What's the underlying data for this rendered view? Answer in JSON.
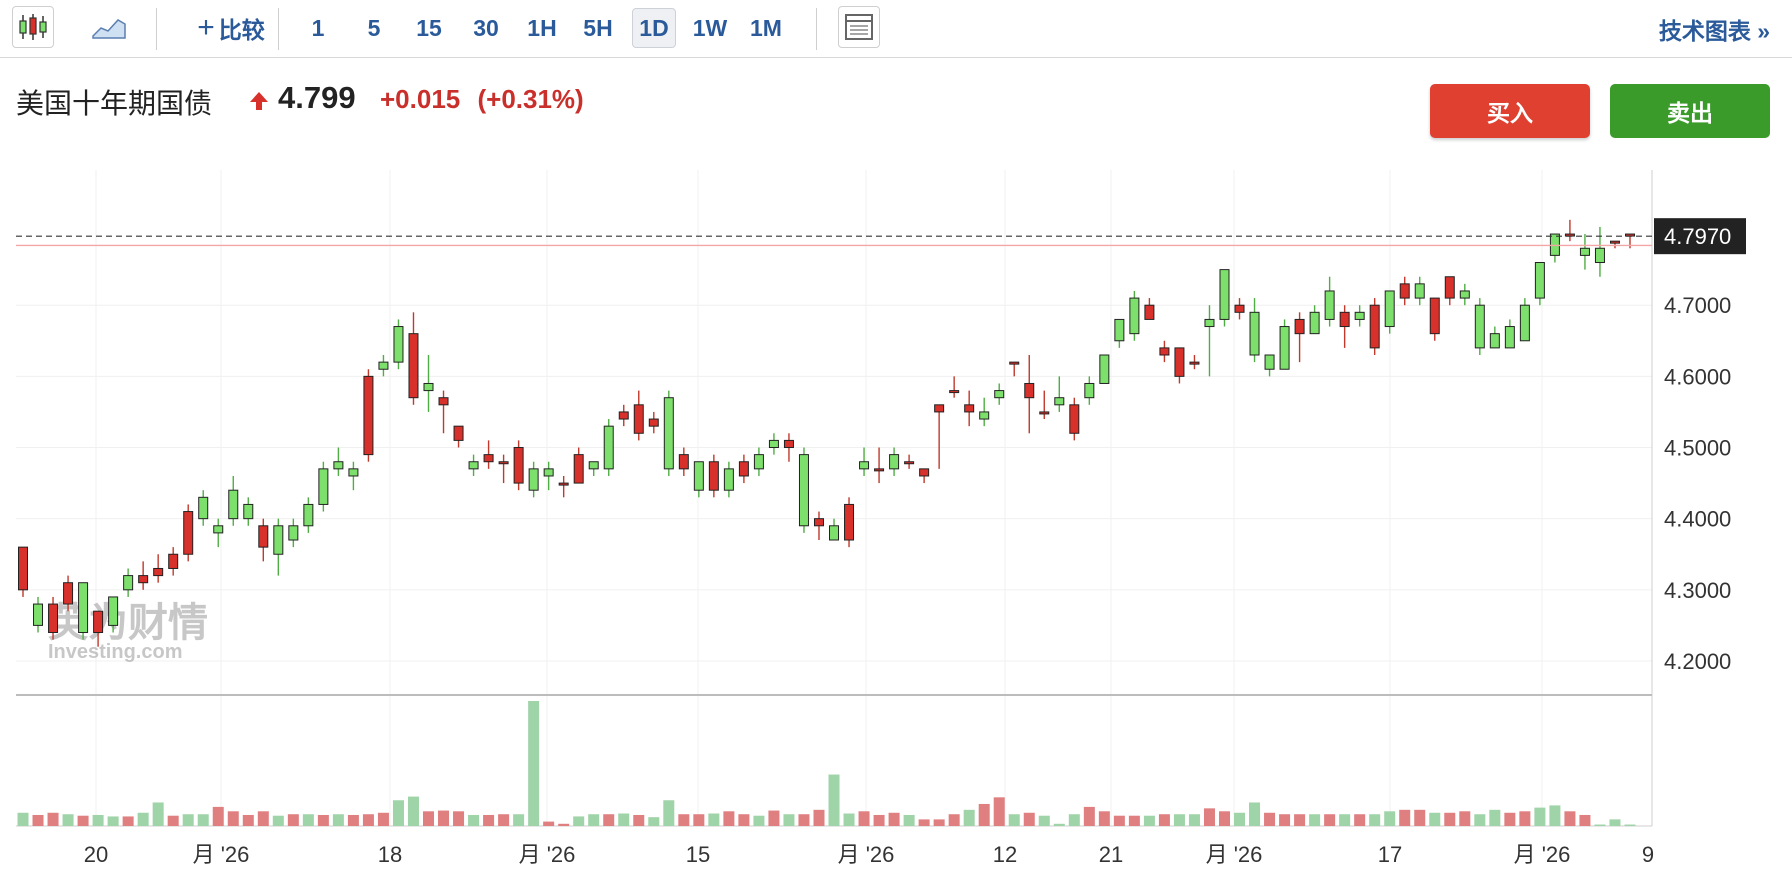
{
  "toolbar": {
    "compare_label": "比较",
    "intervals": [
      "1",
      "5",
      "15",
      "30",
      "1H",
      "5H",
      "1D",
      "1W",
      "1M"
    ],
    "active_interval": "1D",
    "tech_chart_label": "技术图表 »"
  },
  "instrument": {
    "name": "美国十年期国债",
    "price": "4.799",
    "change": "+0.015",
    "change_pct": "(+0.31%)",
    "direction": "up"
  },
  "actions": {
    "buy_label": "买入",
    "sell_label": "卖出"
  },
  "watermark": {
    "cn": "英为财情",
    "en": "Investing.com"
  },
  "colors": {
    "up": "#d8302a",
    "down": "#7ee06c",
    "up_vol": "#df7f80",
    "down_vol": "#9fd3a8",
    "accent": "#2a5a9a"
  },
  "chart_data": {
    "type": "candlestick",
    "current_price_label": "4.7970",
    "current_price": 4.797,
    "ref_price": 4.784,
    "y_ticks": [
      "4.2000",
      "4.3000",
      "4.4000",
      "4.5000",
      "4.6000",
      "4.7000"
    ],
    "ylim": [
      4.155,
      4.89
    ],
    "x_tick_labels": [
      "20",
      "月 '26",
      "18",
      "月 '26",
      "15",
      "月 '26",
      "12",
      "21",
      "月 '26",
      "17",
      "月 '26",
      "9"
    ],
    "candles": [
      [
        4.3,
        4.36,
        4.29,
        4.36
      ],
      [
        4.28,
        4.25,
        4.24,
        4.29
      ],
      [
        4.24,
        4.28,
        4.23,
        4.29
      ],
      [
        4.28,
        4.31,
        4.27,
        4.32
      ],
      [
        4.31,
        4.24,
        4.23,
        4.31
      ],
      [
        4.24,
        4.27,
        4.22,
        4.27
      ],
      [
        4.29,
        4.25,
        4.24,
        4.29
      ],
      [
        4.32,
        4.3,
        4.29,
        4.33
      ],
      [
        4.31,
        4.32,
        4.3,
        4.34
      ],
      [
        4.32,
        4.33,
        4.31,
        4.35
      ],
      [
        4.33,
        4.35,
        4.32,
        4.36
      ],
      [
        4.35,
        4.41,
        4.34,
        4.42
      ],
      [
        4.43,
        4.4,
        4.39,
        4.44
      ],
      [
        4.39,
        4.38,
        4.36,
        4.4
      ],
      [
        4.44,
        4.4,
        4.39,
        4.46
      ],
      [
        4.42,
        4.4,
        4.39,
        4.43
      ],
      [
        4.36,
        4.39,
        4.34,
        4.4
      ],
      [
        4.39,
        4.35,
        4.32,
        4.4
      ],
      [
        4.39,
        4.37,
        4.36,
        4.4
      ],
      [
        4.42,
        4.39,
        4.38,
        4.43
      ],
      [
        4.47,
        4.42,
        4.41,
        4.48
      ],
      [
        4.48,
        4.47,
        4.46,
        4.5
      ],
      [
        4.47,
        4.46,
        4.44,
        4.48
      ],
      [
        4.49,
        4.6,
        4.48,
        4.61
      ],
      [
        4.62,
        4.61,
        4.6,
        4.63
      ],
      [
        4.67,
        4.62,
        4.61,
        4.68
      ],
      [
        4.57,
        4.66,
        4.56,
        4.69
      ],
      [
        4.59,
        4.58,
        4.55,
        4.63
      ],
      [
        4.56,
        4.57,
        4.52,
        4.58
      ],
      [
        4.51,
        4.53,
        4.5,
        4.53
      ],
      [
        4.48,
        4.47,
        4.46,
        4.49
      ],
      [
        4.48,
        4.49,
        4.47,
        4.51
      ],
      [
        4.48,
        4.48,
        4.45,
        4.49
      ],
      [
        4.45,
        4.5,
        4.44,
        4.51
      ],
      [
        4.47,
        4.44,
        4.43,
        4.48
      ],
      [
        4.47,
        4.46,
        4.44,
        4.48
      ],
      [
        4.45,
        4.45,
        4.43,
        4.46
      ],
      [
        4.45,
        4.49,
        4.45,
        4.5
      ],
      [
        4.48,
        4.47,
        4.46,
        4.48
      ],
      [
        4.53,
        4.47,
        4.46,
        4.54
      ],
      [
        4.54,
        4.55,
        4.53,
        4.56
      ],
      [
        4.52,
        4.56,
        4.51,
        4.58
      ],
      [
        4.53,
        4.54,
        4.52,
        4.55
      ],
      [
        4.57,
        4.47,
        4.46,
        4.58
      ],
      [
        4.47,
        4.49,
        4.46,
        4.5
      ],
      [
        4.48,
        4.44,
        4.43,
        4.48
      ],
      [
        4.44,
        4.48,
        4.43,
        4.49
      ],
      [
        4.47,
        4.44,
        4.43,
        4.48
      ],
      [
        4.46,
        4.48,
        4.45,
        4.49
      ],
      [
        4.49,
        4.47,
        4.46,
        4.5
      ],
      [
        4.51,
        4.5,
        4.49,
        4.52
      ],
      [
        4.5,
        4.51,
        4.48,
        4.52
      ],
      [
        4.49,
        4.39,
        4.38,
        4.5
      ],
      [
        4.39,
        4.4,
        4.37,
        4.41
      ],
      [
        4.39,
        4.37,
        4.37,
        4.4
      ],
      [
        4.37,
        4.42,
        4.36,
        4.43
      ],
      [
        4.48,
        4.47,
        4.46,
        4.5
      ],
      [
        4.47,
        4.47,
        4.45,
        4.5
      ],
      [
        4.49,
        4.47,
        4.46,
        4.5
      ],
      [
        4.48,
        4.48,
        4.47,
        4.49
      ],
      [
        4.46,
        4.47,
        4.45,
        4.47
      ],
      [
        4.55,
        4.56,
        4.47,
        4.56
      ],
      [
        4.58,
        4.58,
        4.57,
        4.6
      ],
      [
        4.55,
        4.56,
        4.53,
        4.58
      ],
      [
        4.55,
        4.54,
        4.53,
        4.57
      ],
      [
        4.58,
        4.57,
        4.56,
        4.59
      ],
      [
        4.62,
        4.62,
        4.6,
        4.62
      ],
      [
        4.57,
        4.59,
        4.52,
        4.63
      ],
      [
        4.55,
        4.55,
        4.54,
        4.58
      ],
      [
        4.57,
        4.56,
        4.55,
        4.6
      ],
      [
        4.52,
        4.56,
        4.51,
        4.57
      ],
      [
        4.59,
        4.57,
        4.56,
        4.6
      ],
      [
        4.63,
        4.59,
        4.59,
        4.63
      ],
      [
        4.68,
        4.65,
        4.64,
        4.68
      ],
      [
        4.71,
        4.66,
        4.65,
        4.72
      ],
      [
        4.68,
        4.7,
        4.68,
        4.71
      ],
      [
        4.63,
        4.64,
        4.62,
        4.65
      ],
      [
        4.6,
        4.64,
        4.59,
        4.64
      ],
      [
        4.62,
        4.62,
        4.61,
        4.63
      ],
      [
        4.68,
        4.67,
        4.6,
        4.7
      ],
      [
        4.75,
        4.68,
        4.67,
        4.75
      ],
      [
        4.69,
        4.7,
        4.68,
        4.71
      ],
      [
        4.69,
        4.63,
        4.62,
        4.71
      ],
      [
        4.63,
        4.61,
        4.6,
        4.63
      ],
      [
        4.67,
        4.61,
        4.61,
        4.68
      ],
      [
        4.66,
        4.68,
        4.62,
        4.69
      ],
      [
        4.69,
        4.66,
        4.66,
        4.7
      ],
      [
        4.72,
        4.68,
        4.67,
        4.74
      ],
      [
        4.67,
        4.69,
        4.64,
        4.7
      ],
      [
        4.69,
        4.68,
        4.67,
        4.7
      ],
      [
        4.64,
        4.7,
        4.63,
        4.71
      ],
      [
        4.72,
        4.67,
        4.66,
        4.72
      ],
      [
        4.71,
        4.73,
        4.7,
        4.74
      ],
      [
        4.73,
        4.71,
        4.7,
        4.74
      ],
      [
        4.66,
        4.71,
        4.65,
        4.71
      ],
      [
        4.71,
        4.74,
        4.7,
        4.74
      ],
      [
        4.72,
        4.71,
        4.7,
        4.73
      ],
      [
        4.7,
        4.64,
        4.63,
        4.71
      ],
      [
        4.66,
        4.64,
        4.64,
        4.67
      ],
      [
        4.67,
        4.64,
        4.64,
        4.68
      ],
      [
        4.7,
        4.65,
        4.65,
        4.71
      ],
      [
        4.76,
        4.71,
        4.7,
        4.76
      ],
      [
        4.8,
        4.77,
        4.76,
        4.8
      ],
      [
        4.8,
        4.8,
        4.79,
        4.82
      ],
      [
        4.78,
        4.77,
        4.75,
        4.8
      ],
      [
        4.78,
        4.76,
        4.74,
        4.81
      ],
      [
        4.79,
        4.79,
        4.78,
        4.79
      ],
      [
        4.8,
        4.8,
        4.78,
        4.8
      ]
    ],
    "volumes": [
      [
        1.8,
        0
      ],
      [
        1.5,
        1
      ],
      [
        1.8,
        1
      ],
      [
        1.6,
        0
      ],
      [
        1.4,
        1
      ],
      [
        1.5,
        0
      ],
      [
        1.3,
        0
      ],
      [
        1.3,
        1
      ],
      [
        1.8,
        0
      ],
      [
        3.2,
        0
      ],
      [
        1.4,
        1
      ],
      [
        1.6,
        0
      ],
      [
        1.6,
        0
      ],
      [
        2.6,
        1
      ],
      [
        2.0,
        1
      ],
      [
        1.5,
        1
      ],
      [
        2.0,
        1
      ],
      [
        1.4,
        0
      ],
      [
        1.6,
        1
      ],
      [
        1.6,
        0
      ],
      [
        1.5,
        1
      ],
      [
        1.6,
        0
      ],
      [
        1.5,
        1
      ],
      [
        1.6,
        1
      ],
      [
        1.8,
        1
      ],
      [
        3.5,
        0
      ],
      [
        4.0,
        0
      ],
      [
        2.0,
        1
      ],
      [
        2.1,
        1
      ],
      [
        2.0,
        1
      ],
      [
        1.5,
        0
      ],
      [
        1.5,
        1
      ],
      [
        1.6,
        1
      ],
      [
        1.6,
        0
      ],
      [
        17.0,
        0
      ],
      [
        0.6,
        1
      ],
      [
        0.3,
        1
      ],
      [
        1.3,
        0
      ],
      [
        1.6,
        0
      ],
      [
        1.6,
        1
      ],
      [
        1.7,
        0
      ],
      [
        1.5,
        1
      ],
      [
        1.2,
        0
      ],
      [
        3.5,
        0
      ],
      [
        1.6,
        1
      ],
      [
        1.6,
        1
      ],
      [
        1.7,
        0
      ],
      [
        2.0,
        1
      ],
      [
        1.6,
        1
      ],
      [
        1.4,
        0
      ],
      [
        2.1,
        1
      ],
      [
        1.6,
        0
      ],
      [
        1.6,
        1
      ],
      [
        2.2,
        1
      ],
      [
        7.0,
        0
      ],
      [
        1.7,
        0
      ],
      [
        2.0,
        1
      ],
      [
        1.5,
        1
      ],
      [
        1.8,
        1
      ],
      [
        1.5,
        0
      ],
      [
        0.9,
        1
      ],
      [
        0.9,
        1
      ],
      [
        1.6,
        1
      ],
      [
        2.2,
        0
      ],
      [
        3.0,
        1
      ],
      [
        3.9,
        1
      ],
      [
        1.6,
        0
      ],
      [
        1.8,
        1
      ],
      [
        1.4,
        0
      ],
      [
        0.3,
        0
      ],
      [
        1.6,
        0
      ],
      [
        2.6,
        1
      ],
      [
        2.0,
        1
      ],
      [
        1.4,
        1
      ],
      [
        1.4,
        1
      ],
      [
        1.4,
        0
      ],
      [
        1.6,
        1
      ],
      [
        1.6,
        0
      ],
      [
        1.6,
        0
      ],
      [
        2.4,
        1
      ],
      [
        2.0,
        1
      ],
      [
        1.8,
        0
      ],
      [
        3.2,
        0
      ],
      [
        1.8,
        1
      ],
      [
        1.6,
        1
      ],
      [
        1.6,
        1
      ],
      [
        1.6,
        0
      ],
      [
        1.6,
        1
      ],
      [
        1.6,
        0
      ],
      [
        1.6,
        1
      ],
      [
        1.6,
        0
      ],
      [
        2.0,
        0
      ],
      [
        2.2,
        1
      ],
      [
        2.2,
        1
      ],
      [
        1.8,
        0
      ],
      [
        1.8,
        1
      ],
      [
        2.0,
        1
      ],
      [
        1.6,
        0
      ],
      [
        2.2,
        0
      ],
      [
        1.8,
        1
      ],
      [
        2.0,
        1
      ],
      [
        2.5,
        0
      ],
      [
        2.8,
        0
      ],
      [
        2.0,
        1
      ],
      [
        1.5,
        1
      ],
      [
        0.2,
        0
      ],
      [
        0.9,
        0
      ],
      [
        0.2,
        0
      ]
    ]
  }
}
